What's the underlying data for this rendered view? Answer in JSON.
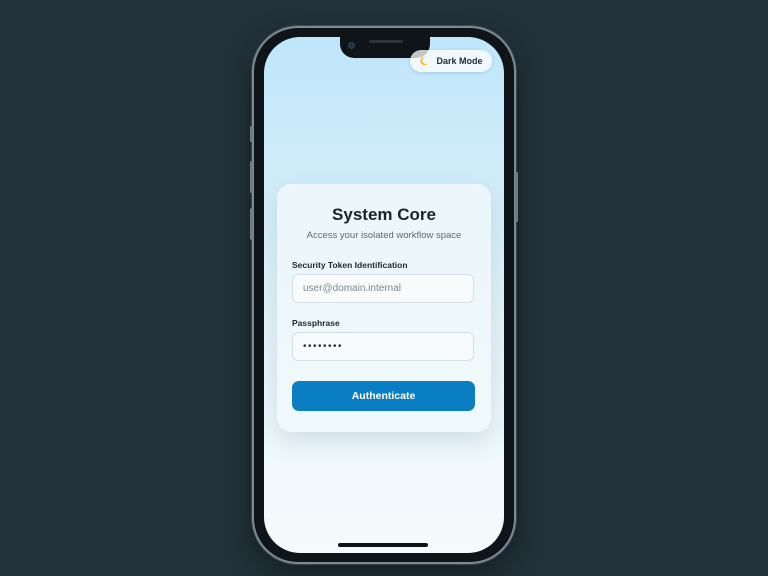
{
  "header": {
    "dark_mode_label": "Dark Mode",
    "dark_mode_icon": "moon-icon"
  },
  "login": {
    "title": "System Core",
    "subtitle": "Access your isolated workflow space",
    "token_label": "Security Token Identification",
    "token_placeholder": "user@domain.internal",
    "token_value": "",
    "passphrase_label": "Passphrase",
    "passphrase_value": "••••••••",
    "submit_label": "Authenticate"
  },
  "colors": {
    "background": "#22313a",
    "accent": "#0a7ec2",
    "screen_top": "#bfe6fb",
    "screen_bottom": "#f6fbfd"
  }
}
